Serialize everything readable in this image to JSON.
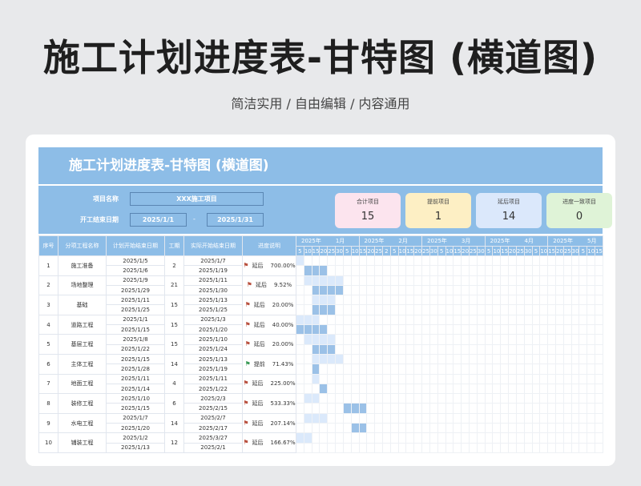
{
  "header": {
    "title": "施工计划进度表-甘特图 (横道图)",
    "subtitle": "简洁实用 / 自由编辑 / 内容通用"
  },
  "card": {
    "banner_title": "施工计划进度表-甘特图 (横道图)",
    "info": {
      "project_label": "项目名称",
      "project_value": "XXX施工项目",
      "dates_label": "开工结束日期",
      "start": "2025/1/1",
      "dash": "-",
      "end": "2025/1/31"
    },
    "stats": [
      {
        "label": "合计项目",
        "value": "15",
        "color": "#fce4ee"
      },
      {
        "label": "提前项目",
        "value": "1",
        "color": "#fdefc4"
      },
      {
        "label": "延后项目",
        "value": "14",
        "color": "#dbe8fb"
      },
      {
        "label": "进度一致项目",
        "value": "0",
        "color": "#dff3d7"
      }
    ]
  },
  "table": {
    "columns": [
      "序号",
      "分项工程名称",
      "计划开始结束日期",
      "工期",
      "实际开始结束日期",
      "进度说明"
    ],
    "months": [
      {
        "year": "2025年",
        "month": "1月",
        "span": 8
      },
      {
        "year": "2025年",
        "month": "2月",
        "span": 8
      },
      {
        "year": "2025年",
        "month": "3月",
        "span": 8
      },
      {
        "year": "2025年",
        "month": "4月",
        "span": 8
      },
      {
        "year": "2025年",
        "month": "5月",
        "span": 7
      }
    ],
    "days": [
      "5",
      "10",
      "15",
      "20",
      "25",
      "30",
      "5",
      "10",
      "15",
      "20",
      "25",
      "2",
      "5",
      "10",
      "15",
      "20",
      "25",
      "30",
      "5",
      "10",
      "15",
      "20",
      "25",
      "30",
      "5",
      "10",
      "15",
      "20",
      "25",
      "30",
      "5",
      "10",
      "15",
      "20",
      "25",
      "30",
      "5",
      "10",
      "15"
    ],
    "rows": [
      {
        "no": "1",
        "name": "施工准备",
        "plan_start": "2025/1/5",
        "plan_end": "2025/1/6",
        "dur": "2",
        "act_start": "2025/1/7",
        "act_end": "2025/1/19",
        "flag": "delay",
        "status": "延后",
        "pct": "700.00%",
        "plan_bar": [
          0,
          0
        ],
        "act_bar": [
          1,
          3
        ]
      },
      {
        "no": "2",
        "name": "场地整理",
        "plan_start": "2025/1/9",
        "plan_end": "2025/1/29",
        "dur": "21",
        "act_start": "2025/1/11",
        "act_end": "2025/1/30",
        "flag": "delay",
        "status": "延后",
        "pct": "9.52%",
        "plan_bar": [
          1,
          5
        ],
        "act_bar": [
          2,
          5
        ]
      },
      {
        "no": "3",
        "name": "基础",
        "plan_start": "2025/1/11",
        "plan_end": "2025/1/25",
        "dur": "15",
        "act_start": "2025/1/13",
        "act_end": "2025/1/25",
        "flag": "delay",
        "status": "延后",
        "pct": "20.00%",
        "plan_bar": [
          2,
          4
        ],
        "act_bar": [
          2,
          4
        ]
      },
      {
        "no": "4",
        "name": "道路工程",
        "plan_start": "2025/1/1",
        "plan_end": "2025/1/15",
        "dur": "15",
        "act_start": "2025/1/3",
        "act_end": "2025/1/20",
        "flag": "delay",
        "status": "延后",
        "pct": "40.00%",
        "plan_bar": [
          0,
          2
        ],
        "act_bar": [
          0,
          3
        ]
      },
      {
        "no": "5",
        "name": "基层工程",
        "plan_start": "2025/1/8",
        "plan_end": "2025/1/22",
        "dur": "15",
        "act_start": "2025/1/10",
        "act_end": "2025/1/24",
        "flag": "delay",
        "status": "延后",
        "pct": "20.00%",
        "plan_bar": [
          1,
          4
        ],
        "act_bar": [
          2,
          4
        ]
      },
      {
        "no": "6",
        "name": "主体工程",
        "plan_start": "2025/1/15",
        "plan_end": "2025/1/28",
        "dur": "14",
        "act_start": "2025/1/13",
        "act_end": "2025/1/19",
        "flag": "ok",
        "status": "提前",
        "pct": "71.43%",
        "plan_bar": [
          2,
          5
        ],
        "act_bar": [
          2,
          2
        ]
      },
      {
        "no": "7",
        "name": "地面工程",
        "plan_start": "2025/1/11",
        "plan_end": "2025/1/14",
        "dur": "4",
        "act_start": "2025/1/11",
        "act_end": "2025/1/22",
        "flag": "delay",
        "status": "延后",
        "pct": "225.00%",
        "plan_bar": [
          2,
          2
        ],
        "act_bar": [
          3,
          3
        ]
      },
      {
        "no": "8",
        "name": "装修工程",
        "plan_start": "2025/1/10",
        "plan_end": "2025/1/15",
        "dur": "6",
        "act_start": "2025/2/3",
        "act_end": "2025/2/15",
        "flag": "delay",
        "status": "延后",
        "pct": "533.33%",
        "plan_bar": [
          1,
          2
        ],
        "act_bar": [
          6,
          8
        ]
      },
      {
        "no": "9",
        "name": "水电工程",
        "plan_start": "2025/1/7",
        "plan_end": "2025/1/20",
        "dur": "14",
        "act_start": "2025/2/7",
        "act_end": "2025/2/17",
        "flag": "delay",
        "status": "延后",
        "pct": "207.14%",
        "plan_bar": [
          1,
          3
        ],
        "act_bar": [
          7,
          8
        ]
      },
      {
        "no": "10",
        "name": "铺装工程",
        "plan_start": "2025/1/2",
        "plan_end": "2025/1/13",
        "dur": "12",
        "act_start": "2025/3/27",
        "act_end": "2025/2/1",
        "flag": "delay",
        "status": "延后",
        "pct": "166.67%",
        "plan_bar": [
          0,
          1
        ],
        "act_bar": [
          -1,
          -1
        ]
      }
    ]
  },
  "colors": {
    "header_blue": "#8dbde7",
    "plan_bar": "#dbe9fb",
    "actual_bar": "#9bc1e7",
    "delay_flag": "#b9513f",
    "early_flag": "#3a9a56"
  },
  "icons": {
    "delay": "red-flag-icon",
    "early": "green-flag-icon"
  }
}
